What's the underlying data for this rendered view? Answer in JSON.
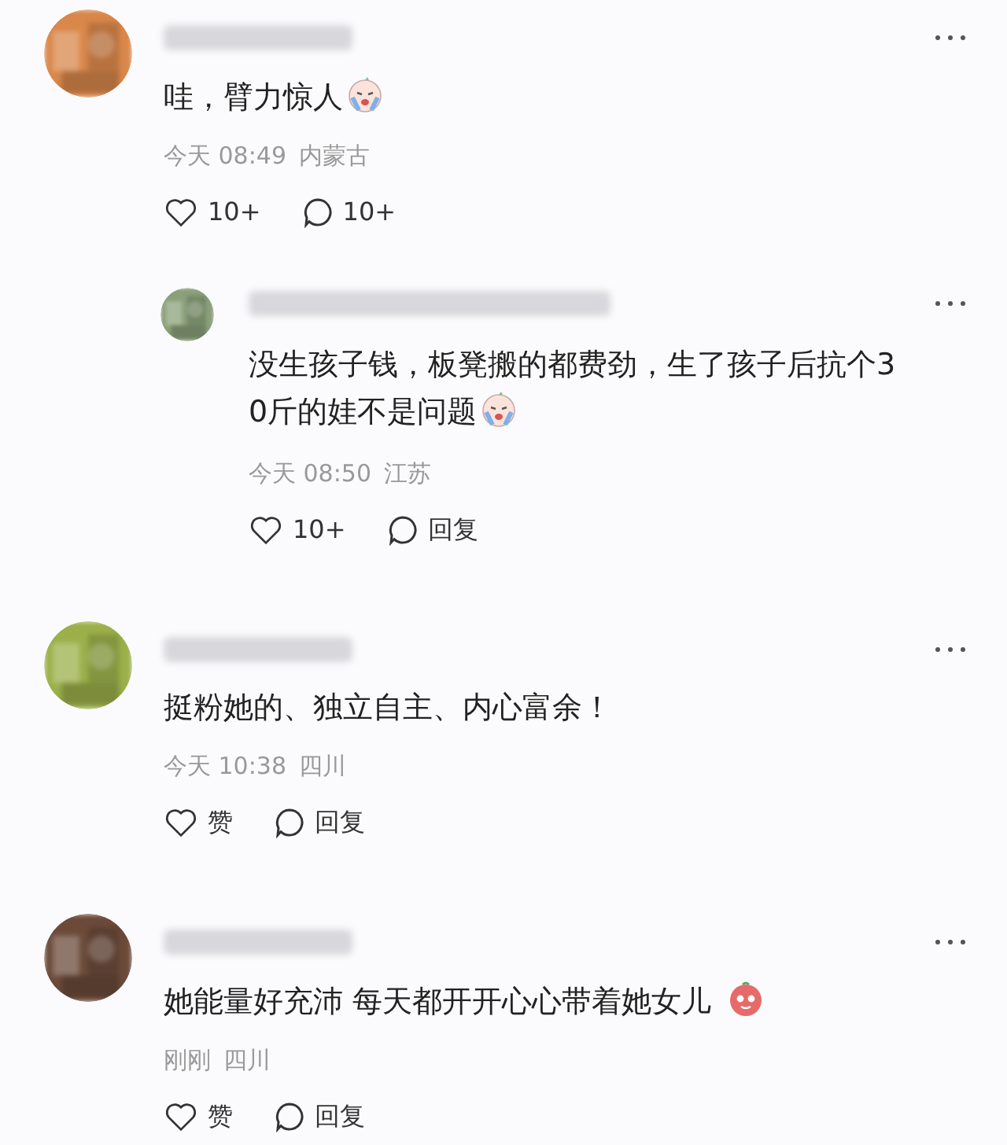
{
  "comments": [
    {
      "color": "#d9874a",
      "text": "哇，臂力惊人",
      "kind": "crying",
      "time": "今天 08:49",
      "location": "内蒙古",
      "like": "10+",
      "reply": "10+",
      "children": [
        {
          "color": "#8aa07a",
          "text": "没生孩子钱，板凳搬的都费劲，生了孩子后抗个30斤的娃不是问题",
          "kind": "crying",
          "time": "今天 08:50",
          "location": "江苏",
          "like": "10+",
          "reply": "回复"
        }
      ]
    },
    {
      "color": "#9bb04a",
      "text": "挺粉她的、独立自主、内心富余！",
      "kind": "plain",
      "time": "今天 10:38",
      "location": "四川",
      "like": "赞",
      "reply": "回复"
    },
    {
      "color": "#6b4a3a",
      "text": "她能量好充沛 每天都开开心心带着她女儿",
      "kind": "blush",
      "time": "刚刚",
      "location": "四川",
      "like": "赞",
      "reply": "回复"
    }
  ]
}
